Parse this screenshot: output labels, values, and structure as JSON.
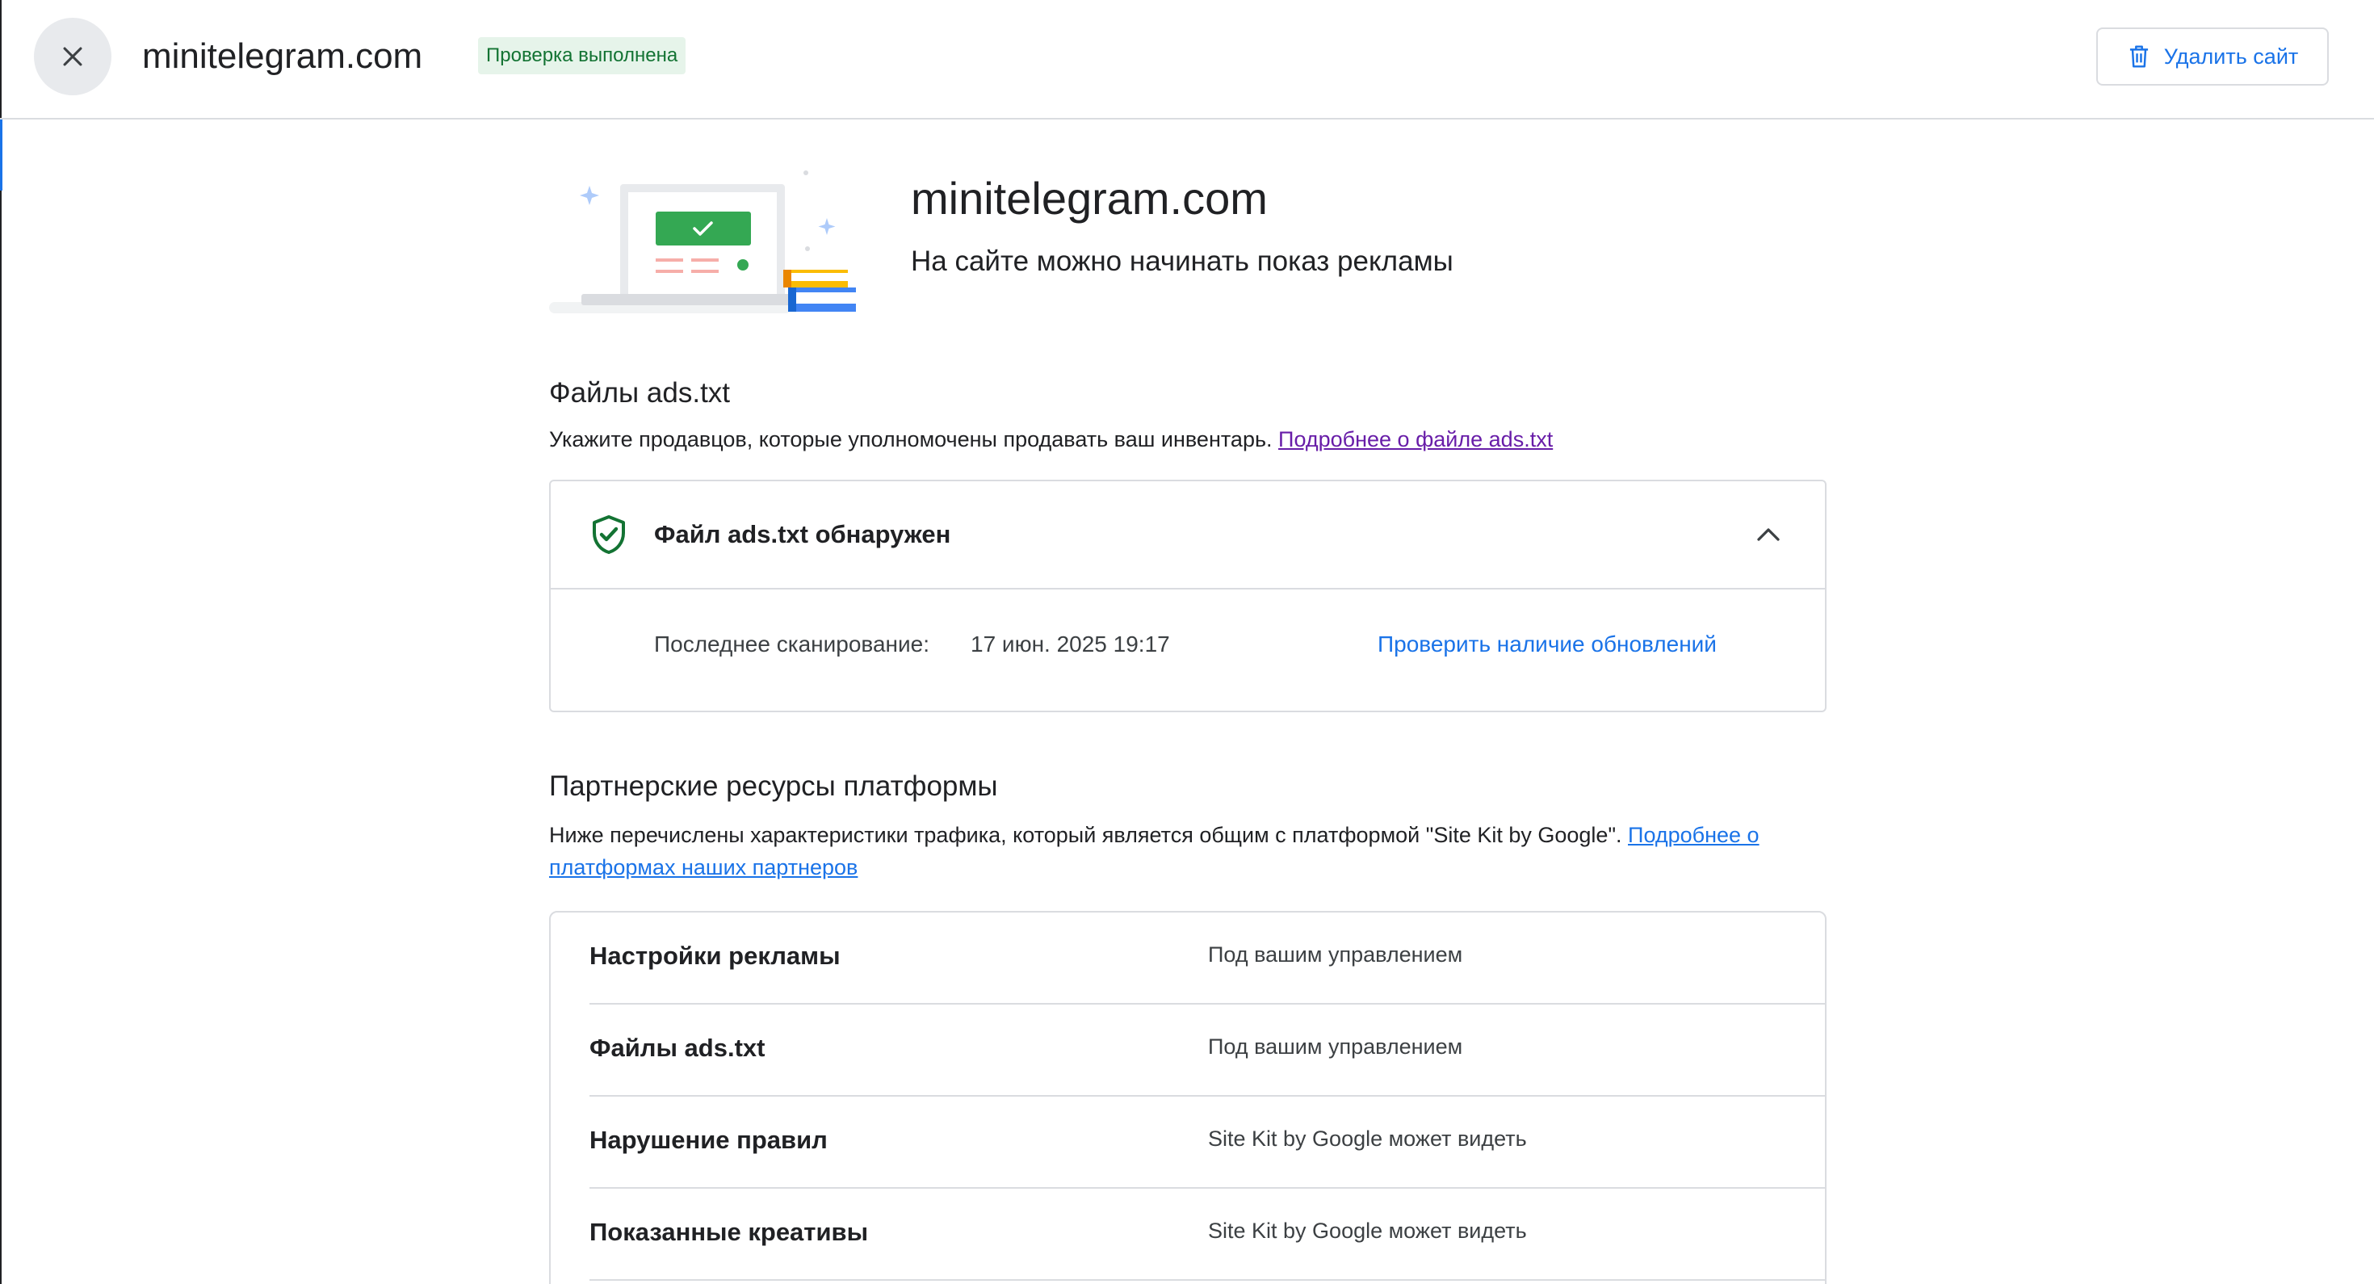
{
  "header": {
    "site_name": "minitelegram.com",
    "status_chip": "Проверка выполнена",
    "delete_label": "Удалить сайт"
  },
  "hero": {
    "domain": "minitelegram.com",
    "status": "На сайте можно начинать показ рекламы"
  },
  "ads_txt": {
    "heading": "Файлы ads.txt",
    "description": "Укажите продавцов, которые уполномочены продавать ваш инвентарь. ",
    "link": "Подробнее о файле ads.txt",
    "card": {
      "title": "Файл ads.txt обнаружен",
      "scan_label": "Последнее сканирование:",
      "scan_date": "17 июн. 2025 19:17",
      "check_link": "Проверить наличие обновлений"
    }
  },
  "partner": {
    "heading": "Партнерские ресурсы платформы",
    "description": "Ниже перечислены характеристики трафика, который является общим с платформой \"Site Kit by Google\". ",
    "link": "Подробнее о платформах наших партнеров",
    "rows": [
      {
        "label": "Настройки рекламы",
        "value": "Под вашим управлением"
      },
      {
        "label": "Файлы ads.txt",
        "value": "Под вашим управлением"
      },
      {
        "label": "Нарушение правил",
        "value": "Site Kit by Google может видеть"
      },
      {
        "label": "Показанные креативы",
        "value": "Site Kit by Google может видеть"
      }
    ]
  },
  "icons": {
    "close": "close-icon",
    "delete": "trash-icon",
    "shield": "shield-check-icon",
    "chevron": "chevron-up-icon",
    "illustration": "site-ready-illustration"
  },
  "colors": {
    "accent": "#1a73e8",
    "success": "#137333",
    "success_bg": "#e6f4ea",
    "visited_link": "#681da8"
  }
}
